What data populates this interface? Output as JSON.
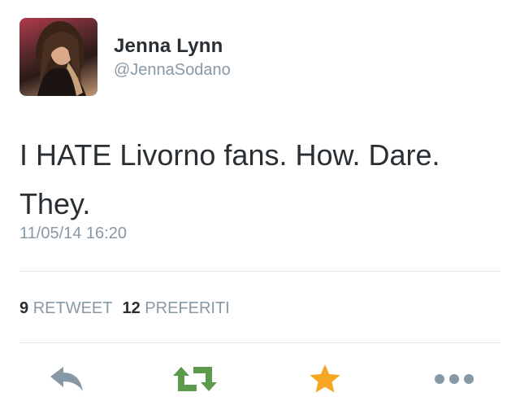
{
  "user": {
    "name": "Jenna Lynn",
    "handle": "@JennaSodano"
  },
  "tweet": {
    "text": "I HATE Livorno fans. How. Dare. They.",
    "timestamp": "11/05/14 16:20"
  },
  "stats": {
    "retweet_count": "9",
    "retweet_label": "RETWEET",
    "favorite_count": "12",
    "favorite_label": "PREFERITI"
  },
  "actions": [
    {
      "icon": "reply-icon"
    },
    {
      "icon": "retweet-icon"
    },
    {
      "icon": "star-icon"
    },
    {
      "icon": "more-icon"
    }
  ],
  "colors": {
    "text": "#292f33",
    "muted": "#8899a6",
    "retweet": "#5c9b4b",
    "favorite": "#f5a623",
    "divider": "#e1e8ed"
  }
}
